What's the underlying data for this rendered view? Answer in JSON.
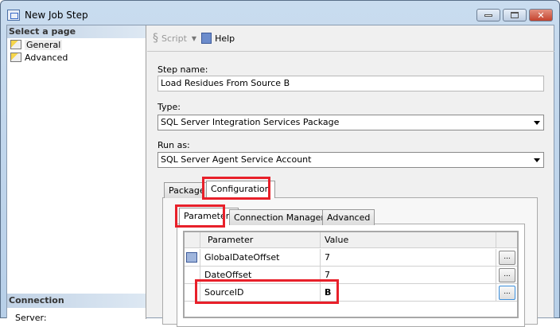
{
  "window": {
    "title": "New Job Step"
  },
  "left": {
    "select_header": "Select a page",
    "pages": [
      {
        "label": "General"
      },
      {
        "label": "Advanced"
      }
    ],
    "connection_header": "Connection",
    "server_label": "Server:"
  },
  "toolbar": {
    "script": "Script",
    "help": "Help"
  },
  "form": {
    "step_name_label": "Step name:",
    "step_name_value": "Load Residues From Source B",
    "type_label": "Type:",
    "type_value": "SQL Server Integration Services Package",
    "run_as_label": "Run as:",
    "run_as_value": "SQL Server Agent Service Account"
  },
  "tabs": {
    "outer": [
      "Package",
      "Configuration"
    ],
    "inner": [
      "Parameters",
      "Connection Managers",
      "Advanced"
    ]
  },
  "grid": {
    "headers": [
      "Parameter",
      "Value"
    ],
    "rows": [
      {
        "parameter": "GlobalDateOffset",
        "value": "7"
      },
      {
        "parameter": "DateOffset",
        "value": "7"
      },
      {
        "parameter": "SourceID",
        "value": "B"
      }
    ],
    "ellipsis": "..."
  }
}
